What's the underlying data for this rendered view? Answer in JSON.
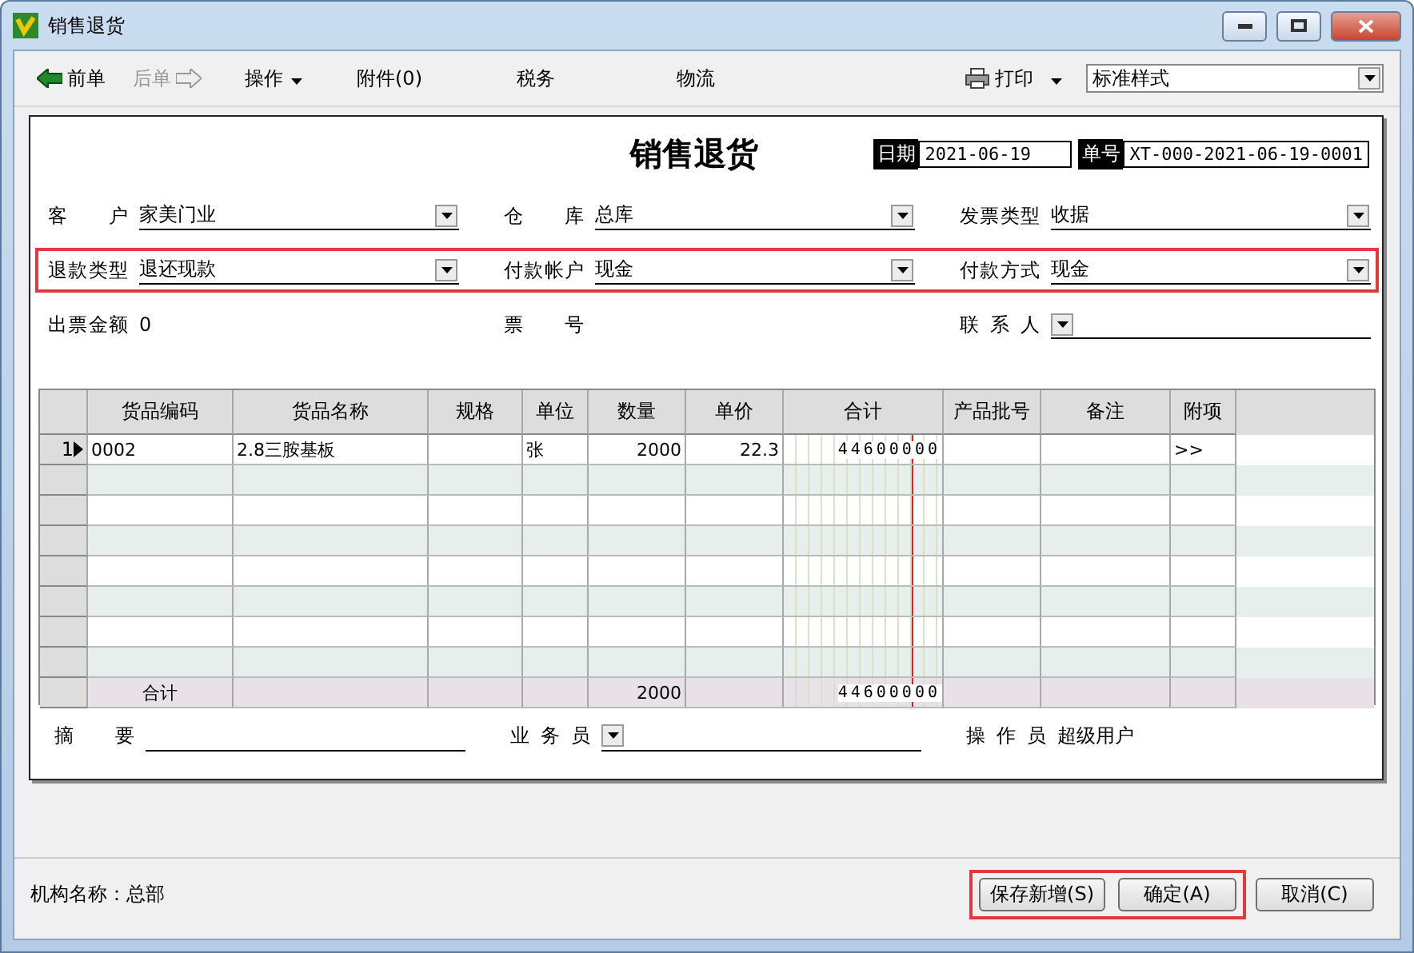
{
  "window": {
    "title": "销售退货"
  },
  "toolbar": [
    {
      "kind": "back",
      "label": "前单",
      "disabled": false
    },
    {
      "kind": "forward",
      "label": "后单",
      "disabled": true
    },
    {
      "kind": "menu",
      "label": "操作",
      "disabled": false
    },
    {
      "kind": "text",
      "label": "附件(0)",
      "disabled": false
    },
    {
      "kind": "text",
      "label": "税务",
      "disabled": false
    },
    {
      "kind": "text",
      "label": "物流",
      "disabled": false
    },
    {
      "kind": "print",
      "label": "打印",
      "disabled": false
    }
  ],
  "style_select": {
    "value": "标准样式"
  },
  "form": {
    "title": "销售退货",
    "date_label": "日期",
    "date": "2021-06-19",
    "number_label": "单号",
    "number": "XT-000-2021-06-19-0001",
    "rows": [
      {
        "highlighted": false,
        "fields": [
          {
            "label": "客 户",
            "value": "家美门业",
            "kind": "dropdown"
          },
          {
            "label": "仓 库",
            "value": "总库",
            "kind": "dropdown"
          },
          {
            "label": "发票类型",
            "value": "收据",
            "kind": "dropdown"
          }
        ]
      },
      {
        "highlighted": true,
        "fields": [
          {
            "label": "退款类型",
            "value": "退还现款",
            "kind": "dropdown"
          },
          {
            "label": "付款帐户",
            "value": "现金",
            "kind": "dropdown"
          },
          {
            "label": "付款方式",
            "value": "现金",
            "kind": "dropdown"
          }
        ]
      },
      {
        "highlighted": false,
        "fields": [
          {
            "label": "出票金额",
            "value": "0",
            "kind": "plain"
          },
          {
            "label": "票 号",
            "kind": "plain"
          },
          {
            "label": "联系人",
            "kind": "dropdown"
          }
        ]
      }
    ],
    "table": {
      "columns": [
        "货品编码",
        "货品名称",
        "规格",
        "单位",
        "数量",
        "单价",
        "合计",
        "产品批号",
        "备注",
        "附项"
      ],
      "rows": [
        {
          "number": "1",
          "selected": true,
          "code": "0002",
          "name": "2.8三胺基板",
          "unit": "张",
          "qty": "2000",
          "price": "22.3",
          "total": "44600000",
          "extra": ">>"
        }
      ],
      "totals": {
        "label": "合计",
        "qty": "2000",
        "total": "44600000"
      }
    },
    "bottom": [
      {
        "label": "摘 要",
        "kind": "line"
      },
      {
        "label": "业务员",
        "kind": "dropdown"
      },
      {
        "label": "操作员",
        "value": "超级用户",
        "kind": "plain"
      }
    ]
  },
  "footer": {
    "org": "机构名称：总部"
  },
  "buttons": [
    {
      "label": "保存新增(S)",
      "highlighted": true
    },
    {
      "label": "确定(A)",
      "highlighted": true
    },
    {
      "label": "取消(C)",
      "highlighted": false
    }
  ]
}
